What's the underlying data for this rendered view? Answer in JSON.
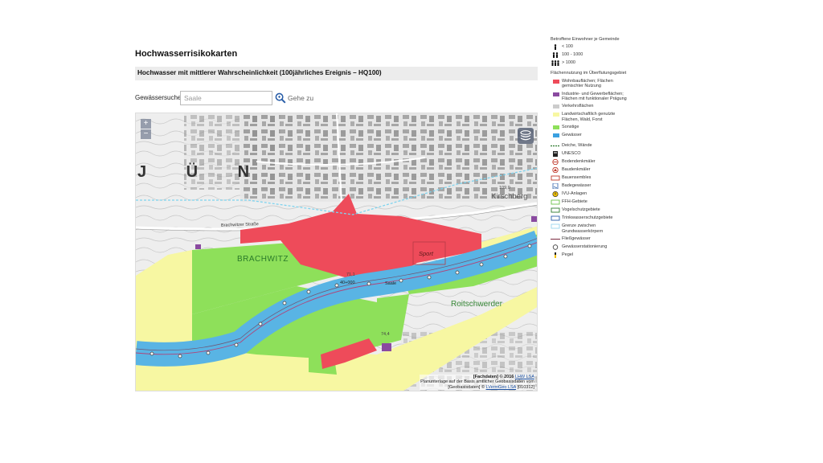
{
  "page": {
    "title": "Hochwasserrisikokarten",
    "subtitle": "Hochwasser mit mittlerer Wahrscheinlichkeit (100jährliches Ereignis – HQ100)"
  },
  "search": {
    "label": "Gewässersuche",
    "placeholder": "Saale",
    "value": "",
    "button_label": "Gehe zu",
    "icon": "magnifier-icon"
  },
  "map": {
    "zoom_in": "+",
    "zoom_out": "−",
    "layer_icon": "layers-icon",
    "place_labels": {
      "jun": "J Ü N",
      "brachwitz": "BRACHWITZ",
      "kirschberg": "Kirschberg",
      "roitschwerder": "Roitschwerder",
      "sport": "Sport",
      "saale": "Saale",
      "station": "40+000",
      "elev1": "109,0",
      "elev2": "71,1",
      "elev3": "74,4",
      "street": "Brachwitzer Straße"
    },
    "colors": {
      "residential": "#ee4b5a",
      "industrial": "#8a4aa0",
      "traffic": "#cccccc",
      "agriculture": "#f7f7a2",
      "other": "#8ee05a",
      "water": "#59b4e4"
    },
    "attribution": {
      "line1_prefix": "[Fachdaten] © 2016 ",
      "line1_link": "LHW LSA",
      "line2": "Planunterlage auf der Basis amtlicher Geobasisdaten vom",
      "line3_prefix": "[Geobasisdaten] © ",
      "line3_link": "LVermGeo LSA",
      "line3_suffix": " [010312]"
    }
  },
  "legend": {
    "affected_header": "Betroffene Einwohner je Gemeinde",
    "affected_items": [
      {
        "label": "< 100",
        "icon": "person-one-icon"
      },
      {
        "label": "100 - 1000",
        "icon": "person-two-icon"
      },
      {
        "label": "> 1000",
        "icon": "person-three-icon"
      }
    ],
    "landuse_header": "Flächennutzung im Überflutungsgebiet",
    "landuse_items": [
      {
        "label": "Wohnbauflächen; Flächen gemischter Nutzung",
        "color": "#ee4b5a"
      },
      {
        "label": "Industrie- und Gewerbeflächen; Flächen mit funktionaler Prägung",
        "color": "#8a4aa0"
      },
      {
        "label": "Verkehrsflächen",
        "color": "#cccccc"
      },
      {
        "label": "Landwirtschaftlich genutzte Flächen, Wald, Forst",
        "color": "#f7f7a2"
      },
      {
        "label": "Sonstige",
        "color": "#8ee05a"
      },
      {
        "label": "Gewässer",
        "color": "#3aa0e0"
      }
    ],
    "feature_items": [
      {
        "label": "Deiche, Wände",
        "icon": "dike-icon"
      },
      {
        "label": "UNESCO",
        "icon": "unesco-icon"
      },
      {
        "label": "Bodendenkmäler",
        "icon": "ground-monument-icon"
      },
      {
        "label": "Baudenkmäler",
        "icon": "building-monument-icon"
      },
      {
        "label": "Bauensembles",
        "icon": "ensemble-icon"
      },
      {
        "label": "Badegewässer",
        "icon": "bathing-water-icon"
      },
      {
        "label": "IVU-Anlagen",
        "icon": "ivu-icon"
      },
      {
        "label": "FFH-Gebiete",
        "icon": "ffh-icon"
      },
      {
        "label": "Vogelschutzgebiete",
        "icon": "bird-protection-icon"
      },
      {
        "label": "Trinkwasserschutzgebiete",
        "icon": "drinking-water-icon"
      },
      {
        "label": "Grenze zwischen Grundwasserkörpern",
        "icon": "groundwater-border-icon"
      },
      {
        "label": "Fließgewässer",
        "icon": "river-icon"
      },
      {
        "label": "Gewässerstationierung",
        "icon": "station-icon"
      },
      {
        "label": "Pegel",
        "icon": "gauge-icon"
      }
    ]
  }
}
